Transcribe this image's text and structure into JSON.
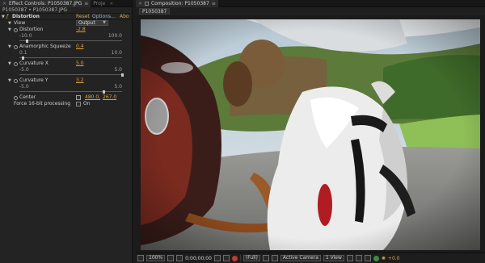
{
  "effect_controls": {
    "tab_label": "Effect Controls: P1050387.JPG",
    "other_tab_label": "Proje",
    "file_line": "P1050387 • P1050387.JPG",
    "effect": {
      "name": "Distortion",
      "reset": "Reset",
      "options": "Options...",
      "about": "Abo"
    },
    "view": {
      "label": "View",
      "value": "Output"
    },
    "distortion": {
      "label": "Distortion",
      "value": "-2.8",
      "min": "-10.0",
      "max": "100.0",
      "level": 0.07
    },
    "anamorphic": {
      "label": "Anamorphic Squeeze",
      "value": "0.4",
      "min": "0.1",
      "max": "10.0",
      "level": 0.03
    },
    "curvature_x": {
      "label": "Curvature X",
      "value": "5.0",
      "min": "-5.0",
      "max": "5.0",
      "level": 1.0
    },
    "curvature_y": {
      "label": "Curvature Y",
      "value": "3.2",
      "min": "-5.0",
      "max": "5.0",
      "level": 0.82
    },
    "center": {
      "label": "Center",
      "x": "480.0,",
      "y": "267.0"
    },
    "force16": {
      "label": "Force 16-bit processing",
      "checkbox_label": "On"
    }
  },
  "composition": {
    "tab_label": "Composition: P1050387",
    "subtab": "P1050387"
  },
  "bottom_bar": {
    "zoom": "100%",
    "timecode": "0;00;00;00",
    "resolution": "(Full)",
    "camera": "Active Camera",
    "views": "1 View",
    "exposure": "+0.0"
  },
  "colors": {
    "accent_value": "#e1a13b",
    "panel_bg": "#232323",
    "viewer_bg": "#1b1b1b"
  }
}
